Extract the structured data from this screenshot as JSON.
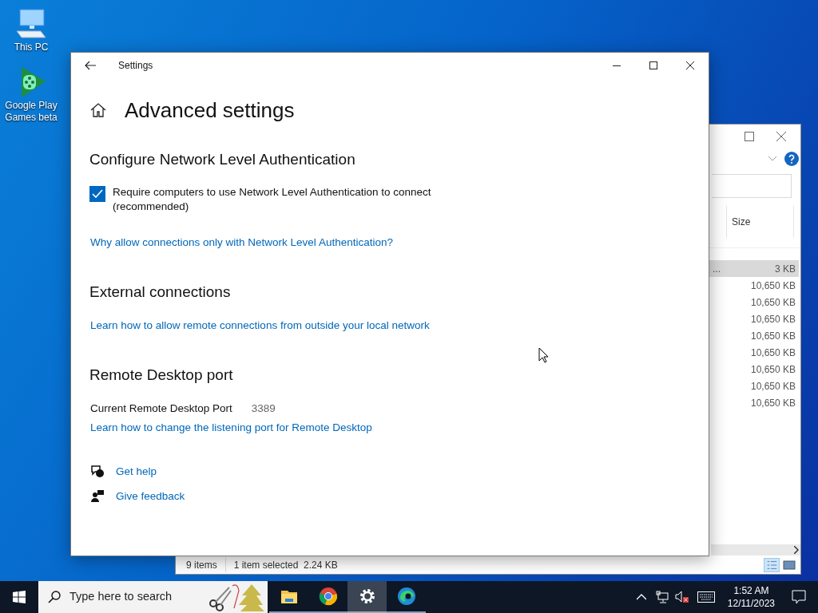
{
  "desktop_icons": [
    {
      "kind": "pc",
      "label": "This PC"
    },
    {
      "kind": "games",
      "label": "Google Play Games beta"
    }
  ],
  "explorer": {
    "column_header": "Size",
    "rows": [
      {
        "name": "...",
        "size": "3 KB",
        "selected": true
      },
      {
        "size": "10,650 KB",
        "selected": false
      },
      {
        "size": "10,650 KB",
        "selected": false
      },
      {
        "size": "10,650 KB",
        "selected": false
      },
      {
        "size": "10,650 KB",
        "selected": false
      },
      {
        "size": "10,650 KB",
        "selected": false
      },
      {
        "size": "10,650 KB",
        "selected": false
      },
      {
        "size": "10,650 KB",
        "selected": false
      },
      {
        "size": "10,650 KB",
        "selected": false
      }
    ],
    "status_bar": {
      "item_count": "9 items",
      "selection": "1 item selected  2.24 KB"
    }
  },
  "settings": {
    "window_title": "Settings",
    "page_title": "Advanced settings",
    "sections": [
      {
        "heading": "Configure Network Level Authentication",
        "items": [
          {
            "kind": "checkbox",
            "label": "Require computers to use Network Level Authentication to connect (recommended)",
            "checked": true
          },
          {
            "kind": "link",
            "text": "Why allow connections only with Network Level Authentication?"
          }
        ]
      },
      {
        "heading": "External connections",
        "items": [
          {
            "kind": "link",
            "text": "Learn how to allow remote connections from outside your local network"
          }
        ]
      },
      {
        "heading": "Remote Desktop port",
        "items": [
          {
            "kind": "field",
            "label": "Current Remote Desktop Port",
            "value": "3389"
          },
          {
            "kind": "link",
            "text": "Learn how to change the listening port for Remote Desktop"
          }
        ]
      }
    ],
    "help_links": [
      {
        "kind": "help",
        "text": "Get help"
      },
      {
        "kind": "feedback",
        "text": "Give feedback"
      }
    ]
  },
  "taskbar": {
    "search_placeholder": "Type here to search",
    "apps": [
      {
        "kind": "folder",
        "selected": false
      },
      {
        "kind": "chrome",
        "selected": false
      },
      {
        "kind": "settings",
        "selected": true
      },
      {
        "kind": "edge",
        "selected": false
      }
    ],
    "time": "1:52 AM",
    "date": "12/11/2023"
  }
}
